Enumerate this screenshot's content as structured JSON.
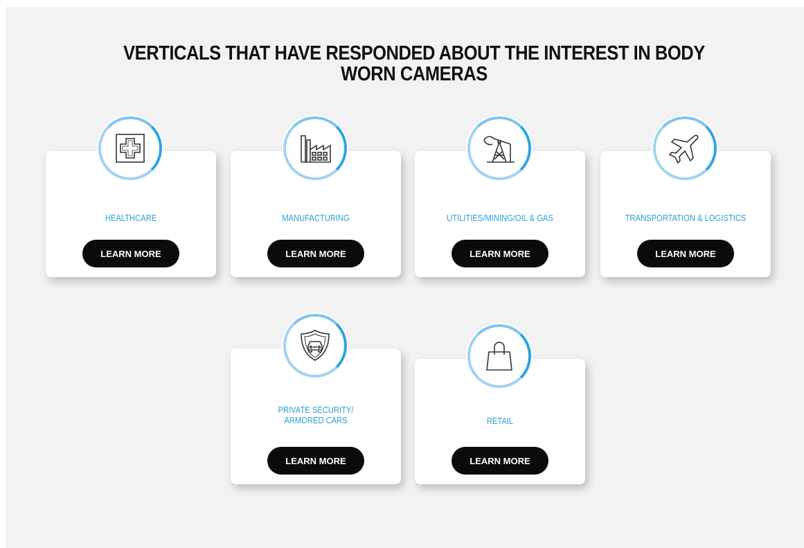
{
  "heading": {
    "line1": "VERTICALS THAT HAVE RESPONDED ABOUT THE INTEREST IN BODY",
    "line2": "WORN CAMERAS"
  },
  "colors": {
    "accent": "#2c9fd8",
    "button_bg": "#0b0b0b",
    "panel_bg": "#f2f2f2"
  },
  "verticals": [
    {
      "icon": "medical-cross-icon",
      "label_line1": "HEALTHCARE",
      "label_line2": "",
      "button": "LEARN MORE"
    },
    {
      "icon": "factory-icon",
      "label_line1": "MANUFACTURING",
      "label_line2": "",
      "button": "LEARN MORE"
    },
    {
      "icon": "oil-pump-icon",
      "label_line1": "UTILITIES/MINING/OIL & GAS",
      "label_line2": "",
      "button": "LEARN MORE"
    },
    {
      "icon": "airplane-icon",
      "label_line1": "TRANSPORTATION & LOGISTICS",
      "label_line2": "",
      "button": "LEARN MORE"
    },
    {
      "icon": "armored-car-shield-icon",
      "label_line1": "PRIVATE SECURITY/",
      "label_line2": "ARMORED CARS",
      "button": "LEARN MORE"
    },
    {
      "icon": "shopping-bag-icon",
      "label_line1": "RETAIL",
      "label_line2": "",
      "button": "LEARN MORE"
    }
  ]
}
